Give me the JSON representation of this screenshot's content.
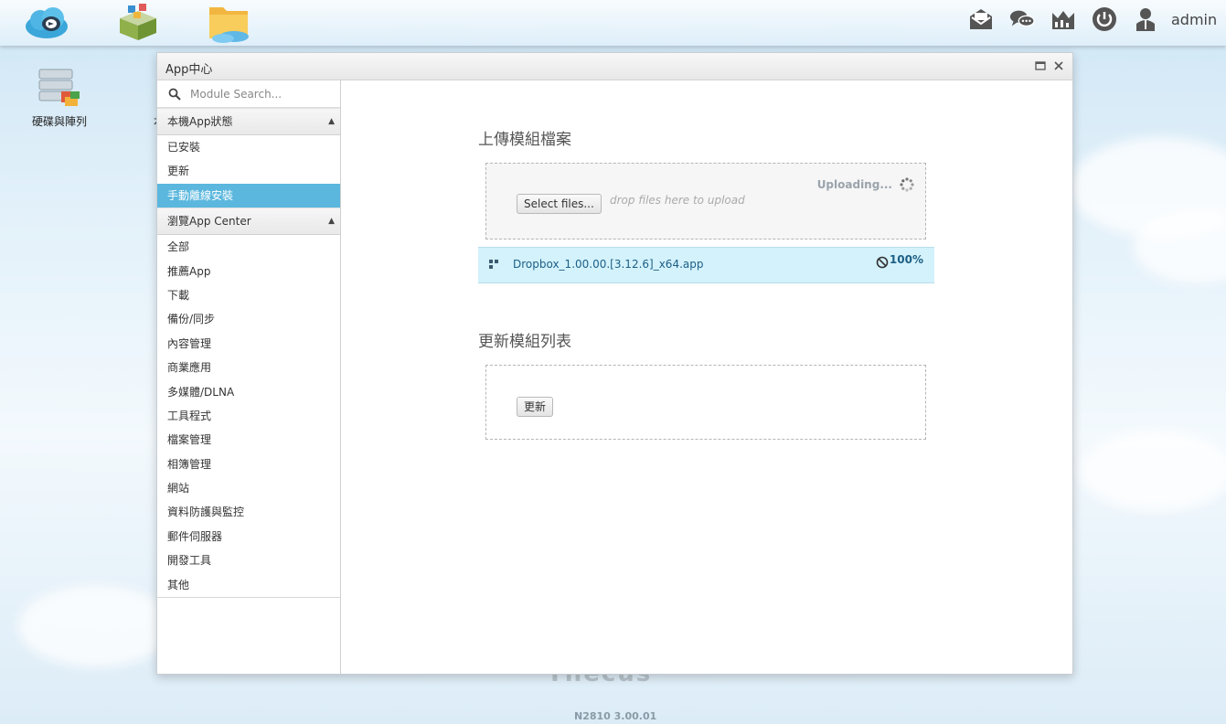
{
  "topbar": {
    "apps": [
      {
        "name": "cloud-dashboard-icon"
      },
      {
        "name": "app-center-icon"
      },
      {
        "name": "file-manager-icon"
      }
    ],
    "right_icons": [
      "mail-icon",
      "chat-icon",
      "monitor-icon",
      "power-icon",
      "user-icon"
    ],
    "username": "admin"
  },
  "desktop": {
    "icons": [
      {
        "label": "硬碟與陣列"
      },
      {
        "label": "本"
      }
    ],
    "footer_version": "N2810   3.00.01",
    "footer_brand": "Thecus"
  },
  "window": {
    "title": "App中心",
    "search": {
      "placeholder": "Module Search..."
    },
    "sections": [
      {
        "title": "本機App狀態",
        "items": [
          "已安裝",
          "更新",
          "手動離線安裝"
        ],
        "active_index": 2
      },
      {
        "title": "瀏覽App Center",
        "items": [
          "全部",
          "推薦App",
          "下載",
          "備份/同步",
          "內容管理",
          "商業應用",
          "多媒體/DLNA",
          "工具程式",
          "檔案管理",
          "相簿管理",
          "網站",
          "資料防護與監控",
          "郵件伺服器",
          "開發工具",
          "其他"
        ]
      }
    ],
    "upload": {
      "title": "上傳模組檔案",
      "select_button": "Select files...",
      "drop_hint": "drop files here to upload",
      "status": "Uploading...",
      "file": {
        "name": "Dropbox_1.00.00.[3.12.6]_x64.app",
        "progress": "100%"
      }
    },
    "update": {
      "title": "更新模組列表",
      "button": "更新"
    }
  },
  "colors": {
    "accent": "#5bb7de",
    "file_row": "#d3f2fb",
    "file_text": "#1d5f86"
  }
}
